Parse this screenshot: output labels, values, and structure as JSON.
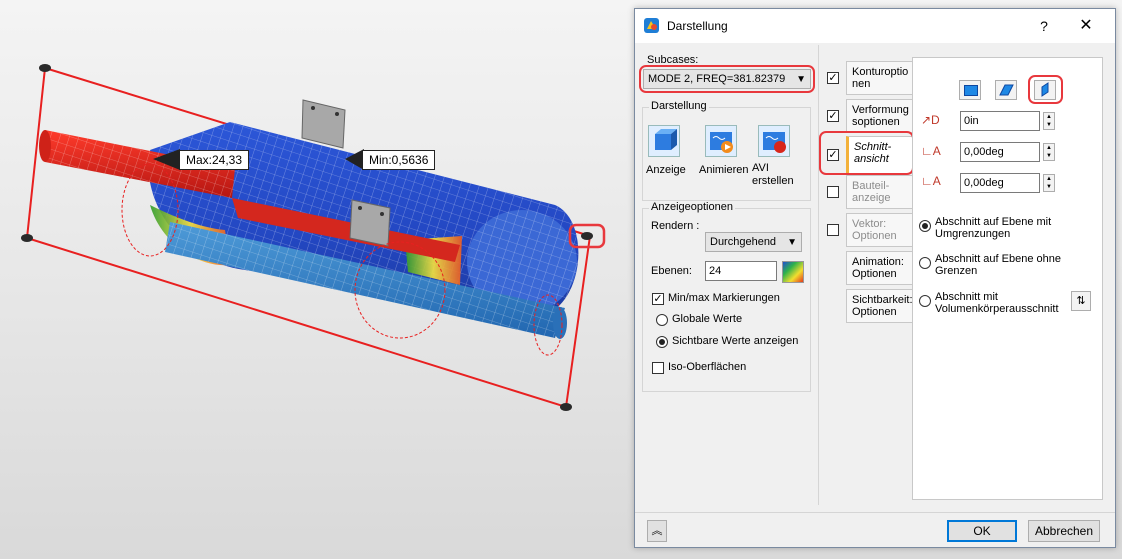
{
  "viewport": {
    "max_label": "Max:24,33",
    "min_label": "Min:0,5636"
  },
  "dialog": {
    "title": "Darstellung",
    "help_glyph": "?",
    "close_glyph": "✕",
    "subcases": {
      "label": "Subcases:",
      "selected": "MODE 2, FREQ=381.82379"
    },
    "darstellung": {
      "label": "Darstellung",
      "buttons": [
        {
          "label": "Anzeige",
          "icon": "display-icon"
        },
        {
          "label": "Animieren",
          "icon": "animate-icon"
        },
        {
          "label": "AVI erstellen",
          "icon": "avi-icon"
        }
      ]
    },
    "anzeigeoptionen": {
      "label": "Anzeigeoptionen",
      "rendern_label": "Rendern :",
      "rendern_value": "Durchgehend",
      "ebenen_label": "Ebenen:",
      "ebenen_value": "24",
      "minmax_label": "Min/max Markierungen",
      "minmax_checked": true,
      "globale_label": "Globale Werte",
      "sichtbare_label": "Sichtbare Werte anzeigen",
      "iso_label": "Iso-Oberflächen",
      "iso_checked": false
    },
    "tabs": [
      {
        "line1": "Konturoptio",
        "line2": "nen",
        "checked": true
      },
      {
        "line1": "Verformung",
        "line2": "soptionen",
        "checked": true
      },
      {
        "line1": "Schnitt-",
        "line2": "ansicht",
        "checked": true
      },
      {
        "line1": "Bauteil-",
        "line2": "anzeige",
        "checked": false
      },
      {
        "line1": "Vektor:",
        "line2": "Optionen",
        "checked": false
      },
      {
        "line1": "Animation:",
        "line2": "Optionen"
      },
      {
        "line1": "Sichtbarkeit:",
        "line2": "Optionen"
      }
    ],
    "section_panel": {
      "offset_value": "0in",
      "angle1_value": "0,00deg",
      "angle2_value": "0,00deg",
      "radio1": "Abschnitt auf Ebene mit Umgrenzungen",
      "radio2": "Abschnitt auf Ebene ohne Grenzen",
      "radio3": "Abschnitt mit Volumenkörperausschnitt"
    },
    "ok_label": "OK",
    "cancel_label": "Abbrechen",
    "highlight_color": "#e8383d"
  }
}
